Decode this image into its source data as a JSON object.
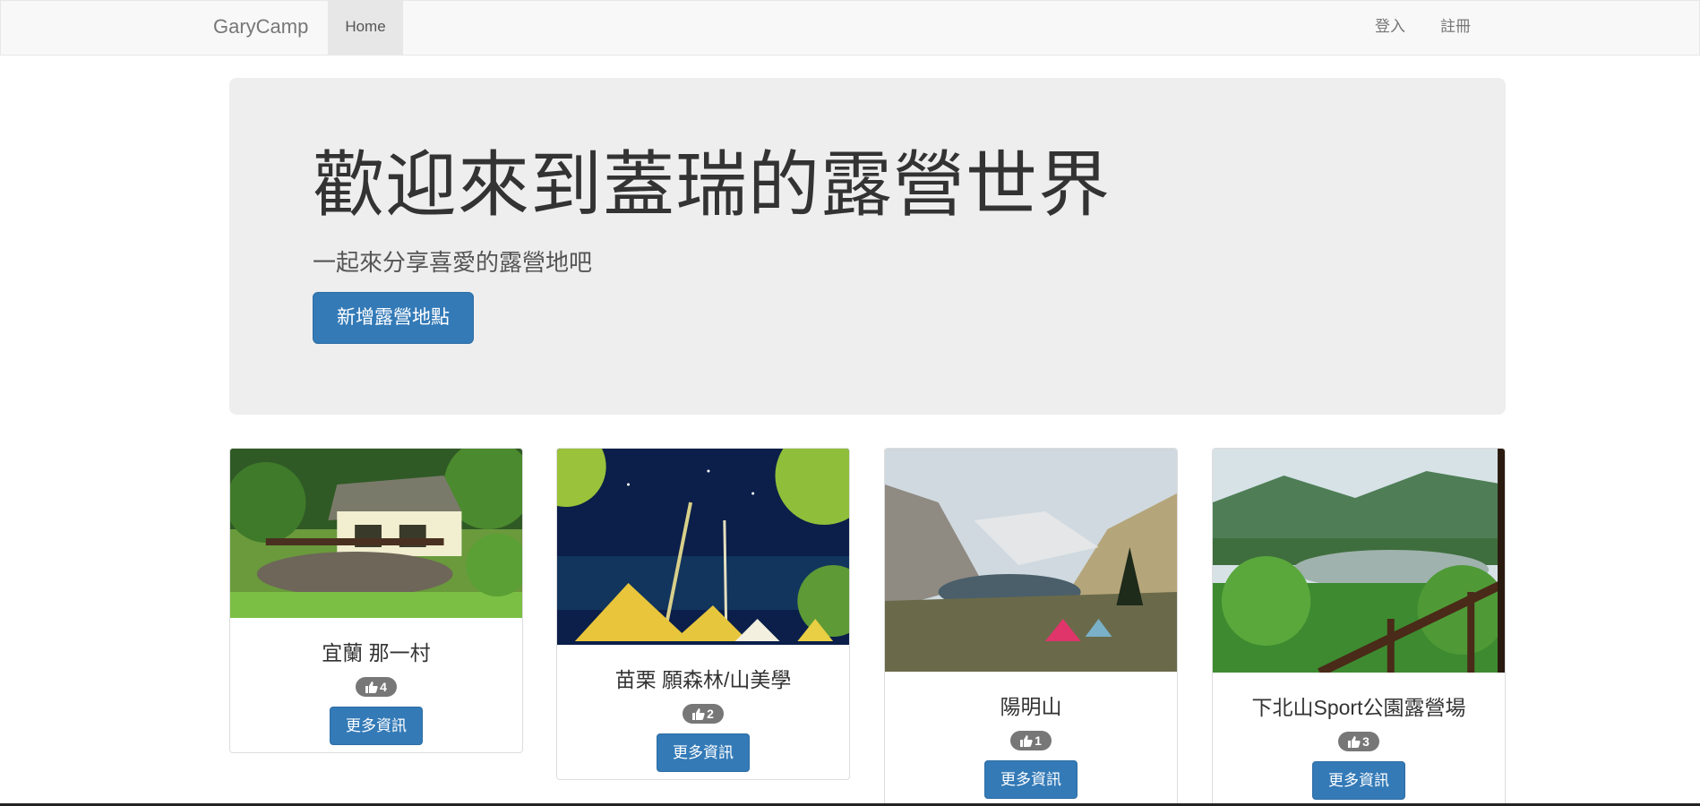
{
  "navbar": {
    "brand": "GaryCamp",
    "home": "Home",
    "login": "登入",
    "register": "註冊"
  },
  "jumbotron": {
    "title": "歡迎來到蓋瑞的露營世界",
    "subtitle": "一起來分享喜愛的露營地吧",
    "button": "新增露營地點"
  },
  "campgrounds": [
    {
      "name": "宜蘭 那一村",
      "likes": "4",
      "button": "更多資訊",
      "image": "cabin-photo"
    },
    {
      "name": "苗栗 願森林/山美學",
      "likes": "2",
      "button": "更多資訊",
      "image": "night-tents-photo"
    },
    {
      "name": "陽明山",
      "likes": "1",
      "button": "更多資訊",
      "image": "mountain-lake-tents-photo"
    },
    {
      "name": "下北山Sport公園露營場",
      "likes": "3",
      "button": "更多資訊",
      "image": "lake-view-railing-photo"
    }
  ],
  "colors": {
    "primary": "#337ab7",
    "badge": "#777777",
    "jumbotron_bg": "#eeeeee",
    "navbar_bg": "#f8f8f8"
  }
}
